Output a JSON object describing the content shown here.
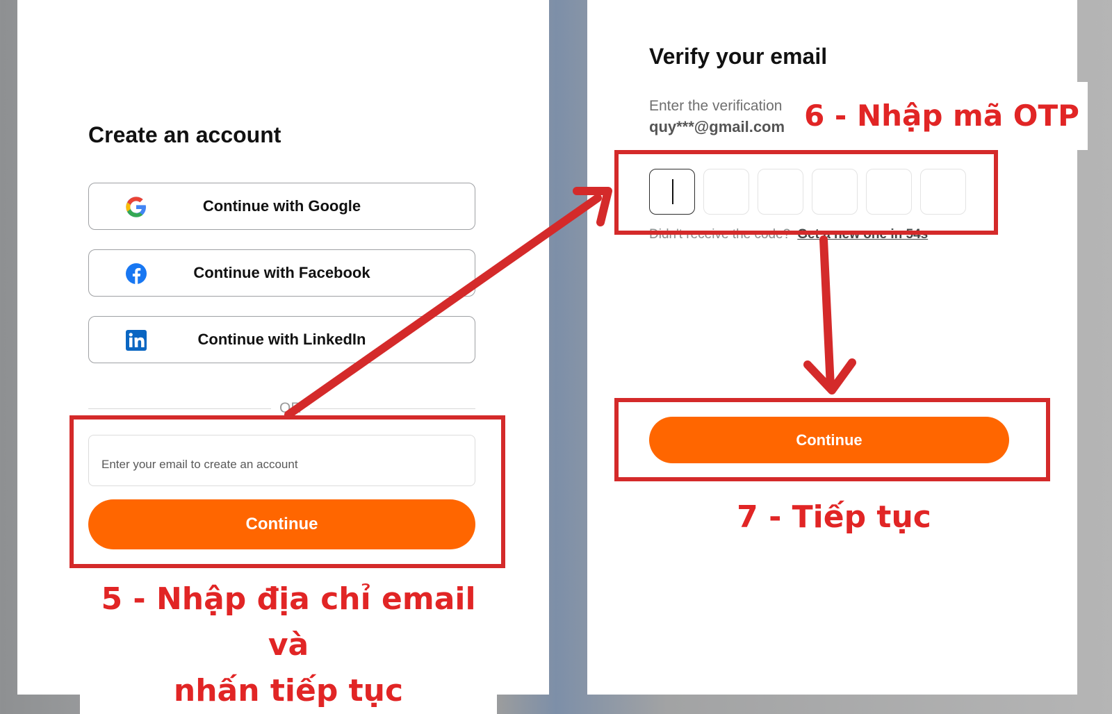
{
  "left_panel": {
    "title": "Create an account",
    "social_buttons": [
      {
        "label": "Continue with Google",
        "icon": "google-icon"
      },
      {
        "label": "Continue with Facebook",
        "icon": "facebook-icon"
      },
      {
        "label": "Continue with LinkedIn",
        "icon": "linkedin-icon"
      }
    ],
    "separator": "OR",
    "email_placeholder": "Enter your email to create an account",
    "continue_label": "Continue"
  },
  "right_panel": {
    "title": "Verify your email",
    "subtitle": "Enter the verification",
    "masked_email": "quy***@gmail.com",
    "otp_length": 6,
    "resend_prefix": "Didn't receive the code?",
    "resend_link": "Get a new one in 54s",
    "continue_label": "Continue"
  },
  "annotations": {
    "step5_line1": "5 - Nhập địa chỉ email và",
    "step5_line2": "nhấn tiếp tục",
    "step6": "6 - Nhập mã OTP",
    "step7": "7 - Tiếp tục"
  },
  "colors": {
    "accent": "#ff6600",
    "annotation_red": "#d42a2a",
    "facebook": "#1877f2",
    "linkedin": "#0a66c2"
  }
}
